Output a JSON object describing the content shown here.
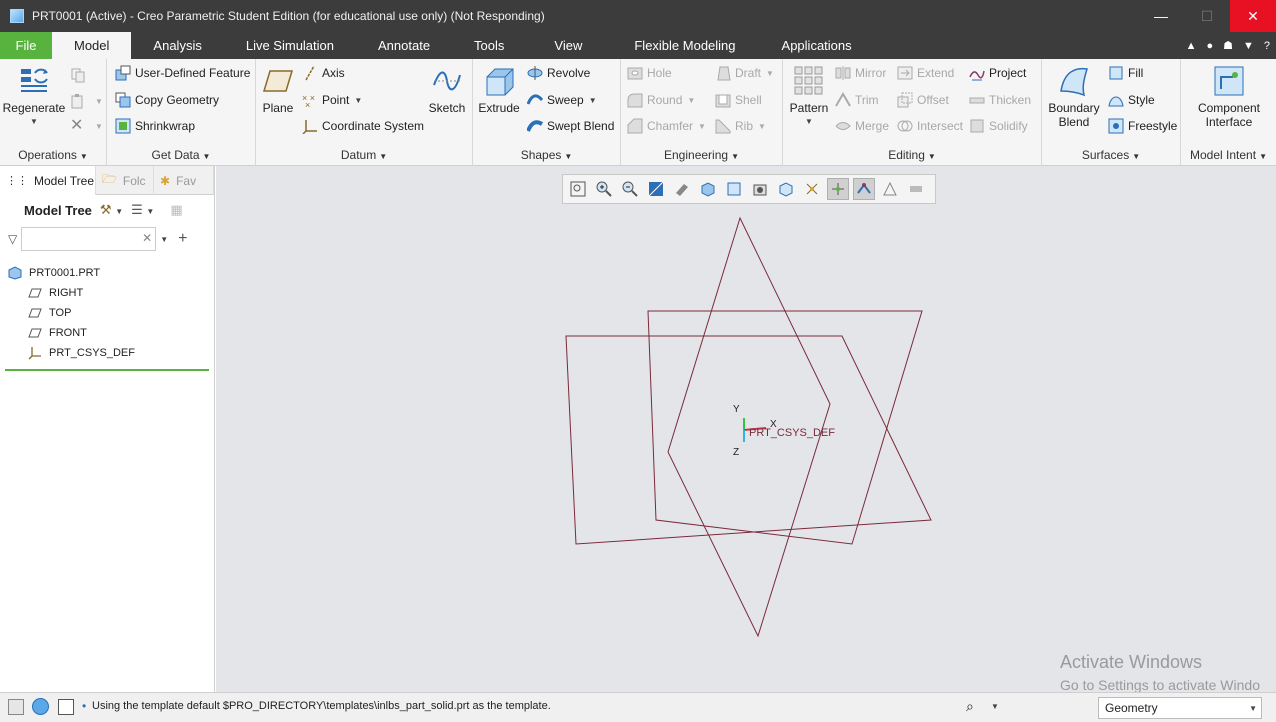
{
  "window": {
    "title": "PRT0001 (Active) - Creo Parametric Student Edition (for educational use only) (Not Responding)",
    "minimize": "—",
    "maximize": "☐",
    "close": "✕"
  },
  "tabs": [
    "File",
    "Model",
    "Analysis",
    "Live Simulation",
    "Annotate",
    "Tools",
    "View",
    "Flexible Modeling",
    "Applications"
  ],
  "active_tab": "Model",
  "ribbon": {
    "operations": {
      "label": "Operations",
      "regenerate": "Regenerate"
    },
    "get_data": {
      "label": "Get Data",
      "items": [
        "User-Defined Feature",
        "Copy Geometry",
        "Shrinkwrap"
      ]
    },
    "datum": {
      "label": "Datum",
      "plane": "Plane",
      "axis": "Axis",
      "point": "Point",
      "csys": "Coordinate System",
      "sketch": "Sketch"
    },
    "shapes": {
      "label": "Shapes",
      "extrude": "Extrude",
      "revolve": "Revolve",
      "sweep": "Sweep",
      "swept_blend": "Swept Blend"
    },
    "engineering": {
      "label": "Engineering",
      "hole": "Hole",
      "round": "Round",
      "chamfer": "Chamfer",
      "draft": "Draft",
      "shell": "Shell",
      "rib": "Rib"
    },
    "editing": {
      "label": "Editing",
      "pattern": "Pattern",
      "mirror": "Mirror",
      "trim": "Trim",
      "merge": "Merge",
      "extend": "Extend",
      "offset": "Offset",
      "intersect": "Intersect",
      "project": "Project",
      "thicken": "Thicken",
      "solidify": "Solidify"
    },
    "surfaces": {
      "label": "Surfaces",
      "boundary_blend": "Boundary Blend",
      "fill": "Fill",
      "style": "Style",
      "freestyle": "Freestyle"
    },
    "model_intent": {
      "label": "Model Intent",
      "component_interface": "Component Interface"
    }
  },
  "left_panel": {
    "tabs": [
      "Model Tree",
      "Folc",
      "Fav"
    ],
    "toolbar_title": "Model Tree",
    "filter_placeholder": "",
    "tree": {
      "root": "PRT0001.PRT",
      "children": [
        "RIGHT",
        "TOP",
        "FRONT",
        "PRT_CSYS_DEF"
      ]
    }
  },
  "graphics": {
    "csys_label": "PRT_CSYS_DEF",
    "axis_x": "X",
    "axis_y": "Y",
    "axis_z": "Z",
    "watermark_title": "Activate Windows",
    "watermark_sub": "Go to Settings to activate Windo"
  },
  "status": {
    "message": "Using the template default $PRO_DIRECTORY\\templates\\inlbs_part_solid.prt as the template.",
    "filter_value": "Geometry"
  },
  "colors": {
    "titlebar": "#3c3c3c",
    "file_tab": "#57b33e",
    "datum_plane": "#7a2a3a",
    "graphics_bg": "#e4e5e9"
  }
}
